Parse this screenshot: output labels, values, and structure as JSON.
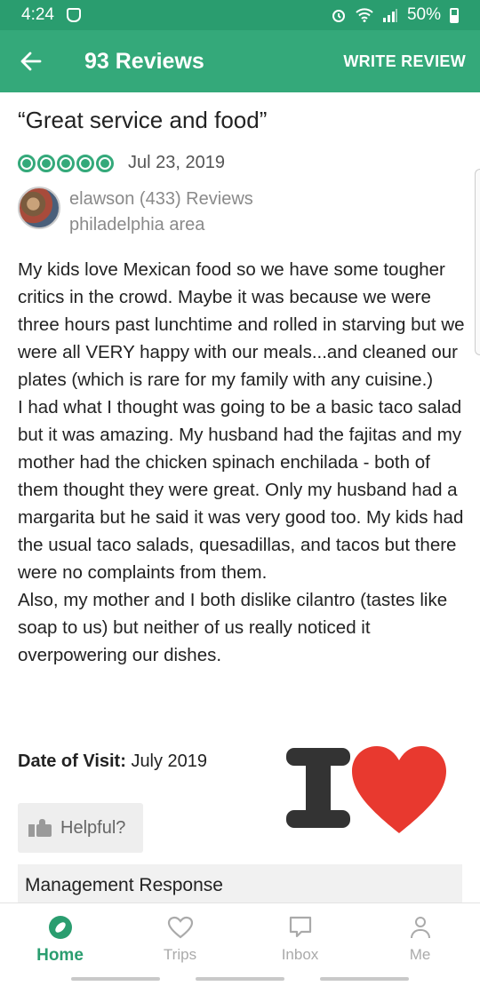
{
  "status_bar": {
    "time": "4:24",
    "battery": "50%",
    "icons": [
      "shield-icon",
      "alarm-icon",
      "wifi-icon",
      "signal-icon",
      "battery-icon"
    ]
  },
  "app_bar": {
    "back_icon": "arrow-left-icon",
    "title": "93 Reviews",
    "action": "WRITE REVIEW",
    "color": "#34a97a"
  },
  "review": {
    "title": "“Great service and food”",
    "rating": 5,
    "rating_max": 5,
    "date": "Jul 23, 2019",
    "reviewer": {
      "name_line": "elawson (433) Reviews",
      "location": "philadelphia area"
    },
    "body_paragraphs": [
      "My kids love Mexican food so we have some tougher critics in the crowd. Maybe it was because we were three hours past lunchtime and rolled in starving but we were all VERY happy with our meals...and cleaned our plates (which is rare for my family with any cuisine.)",
      "I had what I thought was going to be a basic taco salad but it was amazing. My husband had the fajitas and my mother had the chicken spinach enchilada - both of them thought they were great. Only my husband had a margarita but he said it was very good too. My kids had the usual taco salads, quesadillas, and tacos but there were no complaints from them.",
      "Also, my mother and I both dislike cilantro (tastes like soap to us) but neither of us really noticed it overpowering our dishes."
    ],
    "visit_label": "Date of Visit:",
    "visit_value": "July 2019",
    "helpful_label": "Helpful?",
    "management_response_label": "Management Response"
  },
  "sticker": {
    "letter": "I",
    "heart_color": "#e8392f"
  },
  "bottom_nav": {
    "items": [
      {
        "label": "Home",
        "icon": "compass-icon",
        "active": true
      },
      {
        "label": "Trips",
        "icon": "heart-icon",
        "active": false
      },
      {
        "label": "Inbox",
        "icon": "chat-icon",
        "active": false
      },
      {
        "label": "Me",
        "icon": "person-icon",
        "active": false
      }
    ],
    "active_color": "#2a9d6f"
  }
}
